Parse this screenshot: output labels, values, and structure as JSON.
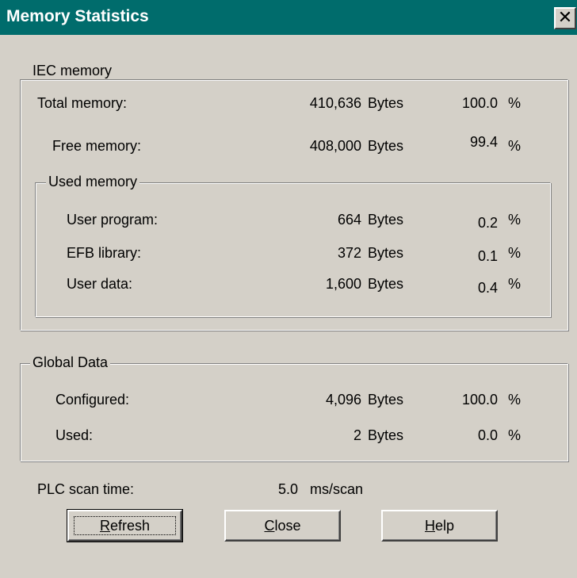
{
  "window": {
    "title": "Memory Statistics",
    "close_glyph": "✕"
  },
  "iec_memory": {
    "legend": "IEC memory",
    "total": {
      "label": "Total memory:",
      "value": "410,636",
      "unit": "Bytes",
      "percent": "100.0",
      "pct_sign": "%"
    },
    "free": {
      "label": "Free memory:",
      "value": "408,000",
      "unit": "Bytes",
      "percent": "99.4",
      "pct_sign": "%"
    },
    "used_memory": {
      "legend": "Used memory",
      "rows": [
        {
          "label": "User program:",
          "value": "664",
          "unit": "Bytes",
          "percent": "0.2",
          "pct_sign": "%"
        },
        {
          "label": "EFB library:",
          "value": "372",
          "unit": "Bytes",
          "percent": "0.1",
          "pct_sign": "%"
        },
        {
          "label": "User data:",
          "value": "1,600",
          "unit": "Bytes",
          "percent": "0.4",
          "pct_sign": "%"
        }
      ]
    }
  },
  "global_data": {
    "legend": "Global Data",
    "rows": [
      {
        "label": "Configured:",
        "value": "4,096",
        "unit": "Bytes",
        "percent": "100.0",
        "pct_sign": "%"
      },
      {
        "label": "Used:",
        "value": "2",
        "unit": "Bytes",
        "percent": "0.0",
        "pct_sign": "%"
      }
    ]
  },
  "scan_time": {
    "label": "PLC scan time:",
    "value": "5.0",
    "unit": "ms/scan"
  },
  "buttons": {
    "refresh": {
      "mnemonic": "R",
      "rest": "efresh"
    },
    "close": {
      "mnemonic": "C",
      "rest": "lose"
    },
    "help": {
      "mnemonic": "H",
      "rest": "elp"
    }
  }
}
